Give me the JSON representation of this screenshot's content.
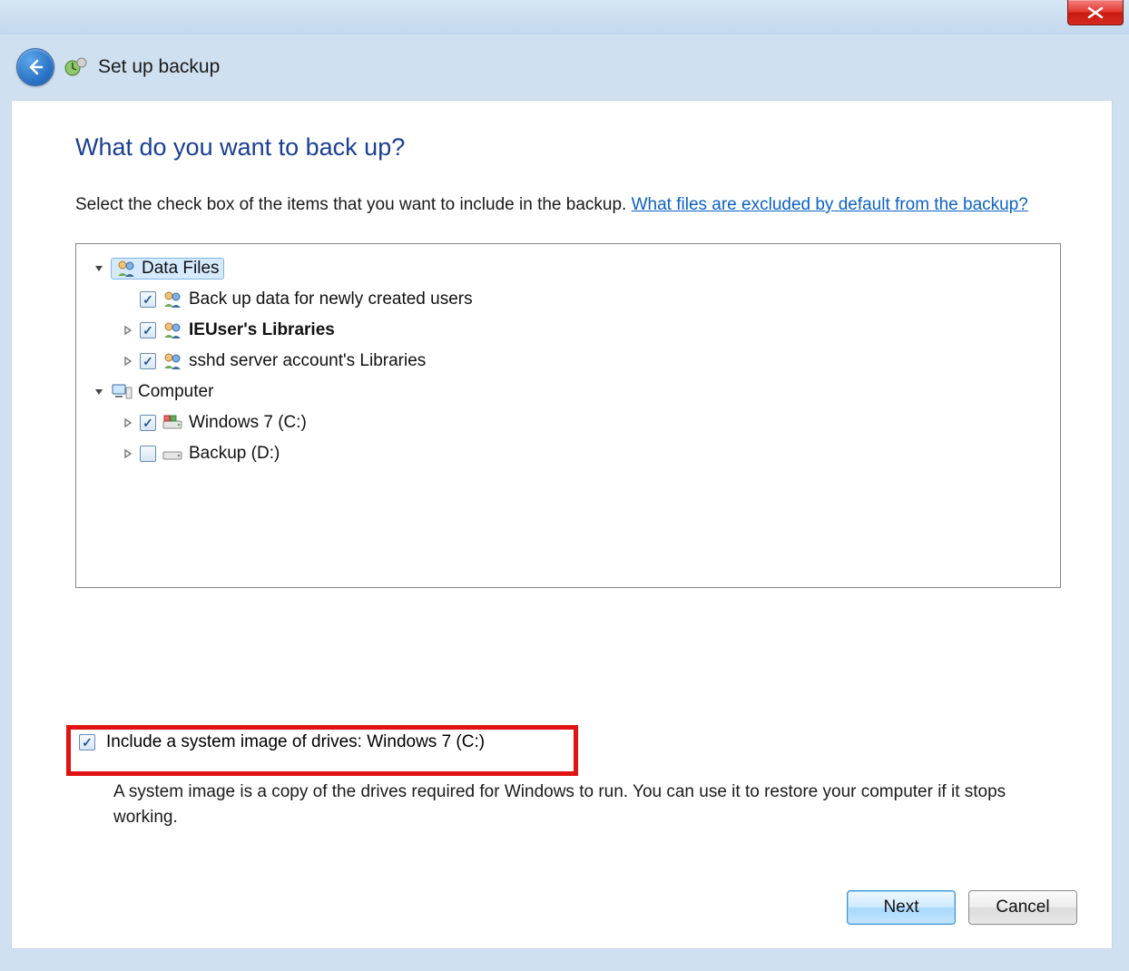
{
  "titlebar": {
    "close_tooltip": "Close"
  },
  "header": {
    "title": "Set up backup"
  },
  "main": {
    "heading": "What do you want to back up?",
    "instruction_before_link": "Select the check box of the items that you want to include in the backup. ",
    "help_link": "What files are excluded by default from the backup?"
  },
  "tree": {
    "data_files": {
      "label": "Data Files",
      "expanded": true,
      "children": [
        {
          "label": "Back up data for newly created users",
          "checked": true,
          "expander": "none",
          "bold": false
        },
        {
          "label": "IEUser's Libraries",
          "checked": true,
          "expander": "collapsed",
          "bold": true
        },
        {
          "label": "sshd server account's Libraries",
          "checked": true,
          "expander": "collapsed",
          "bold": false
        }
      ]
    },
    "computer": {
      "label": "Computer",
      "expanded": true,
      "children": [
        {
          "label": "Windows 7 (C:)",
          "checked": true,
          "expander": "collapsed"
        },
        {
          "label": "Backup (D:)",
          "checked": false,
          "expander": "collapsed"
        }
      ]
    }
  },
  "system_image": {
    "checked": true,
    "label": "Include a system image of drives: Windows 7 (C:)",
    "description": "A system image is a copy of the drives required for Windows to run. You can use it to restore your computer if it stops working."
  },
  "buttons": {
    "next": "Next",
    "cancel": "Cancel"
  }
}
